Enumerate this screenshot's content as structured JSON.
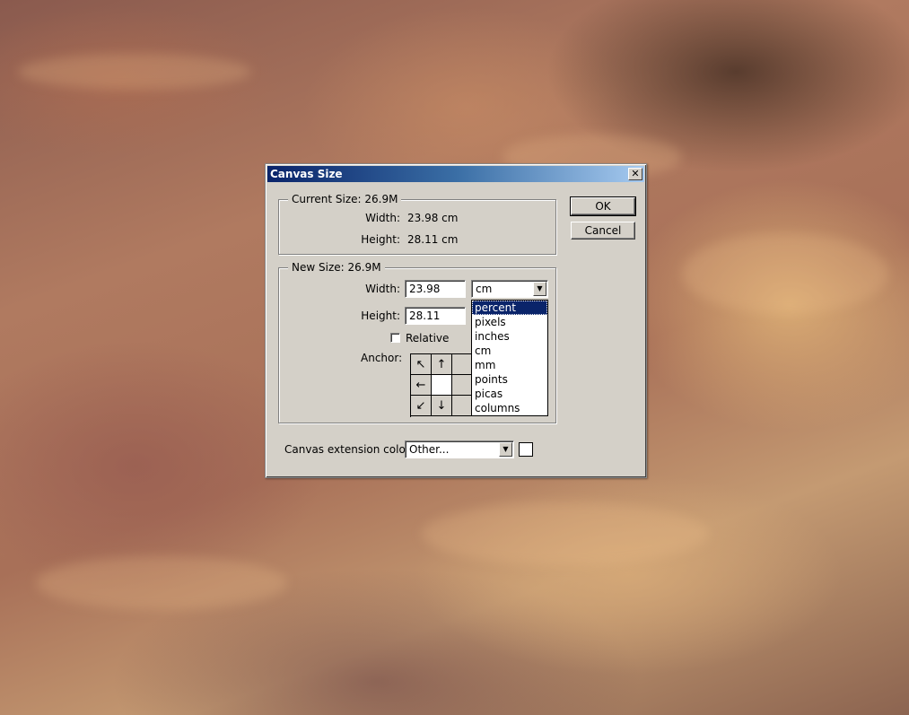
{
  "dialog": {
    "title": "Canvas Size",
    "close_glyph": "✕",
    "ok_label": "OK",
    "cancel_label": "Cancel"
  },
  "current_size": {
    "legend": "Current Size: 26.9M",
    "width_label": "Width:",
    "width_value": "23.98 cm",
    "height_label": "Height:",
    "height_value": "28.11 cm"
  },
  "new_size": {
    "legend": "New Size: 26.9M",
    "width_label": "Width:",
    "width_value": "23.98",
    "height_label": "Height:",
    "height_value": "28.11",
    "unit_selected": "cm",
    "unit_options": [
      "percent",
      "pixels",
      "inches",
      "cm",
      "mm",
      "points",
      "picas",
      "columns"
    ],
    "highlighted_option": "percent",
    "relative_label": "Relative",
    "relative_checked": false,
    "anchor_label": "Anchor:",
    "anchor_arrows": [
      "↖",
      "↑",
      "",
      "←",
      "",
      "",
      "↙",
      "↓",
      ""
    ]
  },
  "extension": {
    "label": "Canvas extension color:",
    "value": "Other...",
    "swatch_color": "#ffffff"
  }
}
